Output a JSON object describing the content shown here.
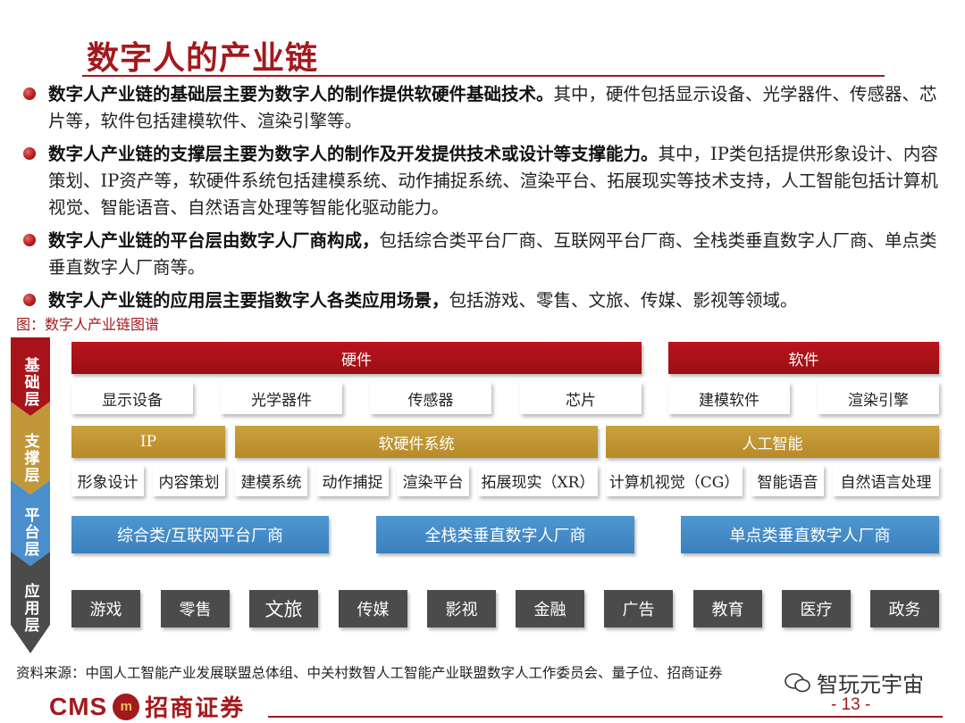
{
  "title": "数字人的产业链",
  "bullets": [
    {
      "bold": "数字人产业链的基础层主要为数字人的制作提供软硬件基础技术。",
      "rest": "其中，硬件包括显示设备、光学器件、传感器、芯片等，软件包括建模软件、渲染引擎等。"
    },
    {
      "bold": "数字人产业链的支撑层主要为数字人的制作及开发提供技术或设计等支撑能力。",
      "rest": "其中，IP类包括提供形象设计、内容策划、IP资产等，软硬件系统包括建模系统、动作捕捉系统、渲染平台、拓展现实等技术支持，人工智能包括计算机视觉、智能语音、自然语言处理等智能化驱动能力。"
    },
    {
      "bold": "数字人产业链的平台层由数字人厂商构成，",
      "rest": "包括综合类平台厂商、互联网平台厂商、全栈类垂直数字人厂商、单点类垂直数字人厂商等。"
    },
    {
      "bold": "数字人产业链的应用层主要指数字人各类应用场景，",
      "rest": "包括游戏、零售、文旅、传媒、影视等领域。"
    }
  ],
  "figure_caption": "图：数字人产业链图谱",
  "layers": {
    "base": "基础层",
    "support": "支撑层",
    "platform": "平台层",
    "application": "应用层"
  },
  "base": {
    "hardware": "硬件",
    "software": "软件",
    "cells": [
      "显示设备",
      "光学器件",
      "传感器",
      "芯片",
      "建模软件",
      "渲染引擎"
    ]
  },
  "support": {
    "ip": "IP",
    "system": "软硬件系统",
    "ai": "人工智能",
    "cells": [
      "形象设计",
      "内容策划",
      "建模系统",
      "动作捕捉",
      "渲染平台",
      "拓展现实（XR）",
      "计算机视觉（CG）",
      "智能语音",
      "自然语言处理"
    ]
  },
  "platform": [
    "综合类/互联网平台厂商",
    "全栈类垂直数字人厂商",
    "单点类垂直数字人厂商"
  ],
  "applications": [
    "游戏",
    "零售",
    "文旅",
    "传媒",
    "影视",
    "金融",
    "广告",
    "教育",
    "医疗",
    "政务"
  ],
  "source": "资料来源：中国人工智能产业发展联盟总体组、中关村数智人工智能产业联盟数字人工作委员会、量子位、招商证券",
  "footer": {
    "logo_cms": "CMS",
    "logo_name": "招商证券",
    "page": "- 13 -",
    "watermark": "智玩元宇宙"
  },
  "colors": {
    "brand_red": "#a3191d",
    "base_red": "#a8131a",
    "support_gold": "#c1973a",
    "platform_blue": "#4a8fcc",
    "application_gray": "#4b4b4b"
  }
}
